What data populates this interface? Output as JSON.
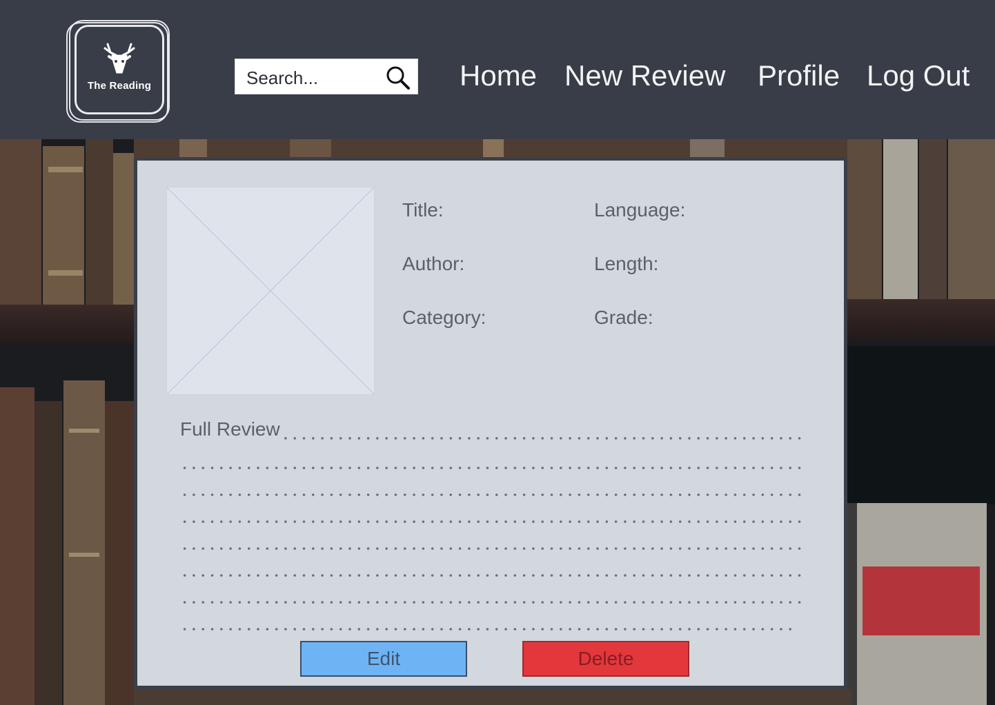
{
  "header": {
    "logo_text": "The Reading",
    "search": {
      "placeholder": "Search..."
    },
    "nav": [
      {
        "label": "Home"
      },
      {
        "label": "New Review"
      },
      {
        "label": "Profile"
      },
      {
        "label": "Log Out"
      }
    ]
  },
  "review_card": {
    "fields_left": [
      "Title:",
      "Author:",
      "Category:"
    ],
    "fields_right": [
      "Language:",
      "Length:",
      "Grade:"
    ],
    "full_review_label": "Full Review",
    "edit_label": "Edit",
    "delete_label": "Delete"
  },
  "colors": {
    "header_bg": "#393d47",
    "card_bg": "#d3d7de",
    "edit_button": "#6eb4f4",
    "delete_button": "#e2383c"
  },
  "icons": [
    "deer-logo-icon",
    "search-icon",
    "image-placeholder-icon"
  ]
}
